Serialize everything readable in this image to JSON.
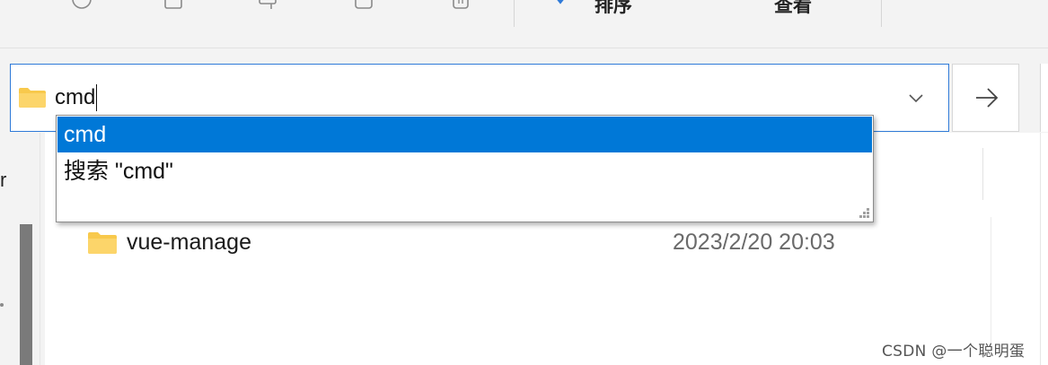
{
  "toolbar": {
    "sort_label": "排序",
    "view_label": "查看"
  },
  "address_bar": {
    "value": "cmd"
  },
  "autocomplete": {
    "items": [
      {
        "label": "cmd",
        "selected": true
      },
      {
        "label": "搜索 \"cmd\"",
        "selected": false
      }
    ]
  },
  "nav_pane": {
    "partial_text": "r"
  },
  "file_list": {
    "rows": [
      {
        "name": "vue-manage",
        "modified": "2023/2/20 20:03",
        "icon": "folder-icon"
      }
    ]
  },
  "watermark": "CSDN @一个聪明蛋",
  "colors": {
    "accent": "#0078d7",
    "address_border": "#2f7ad8",
    "folder_yellow": "#f8c94c"
  }
}
